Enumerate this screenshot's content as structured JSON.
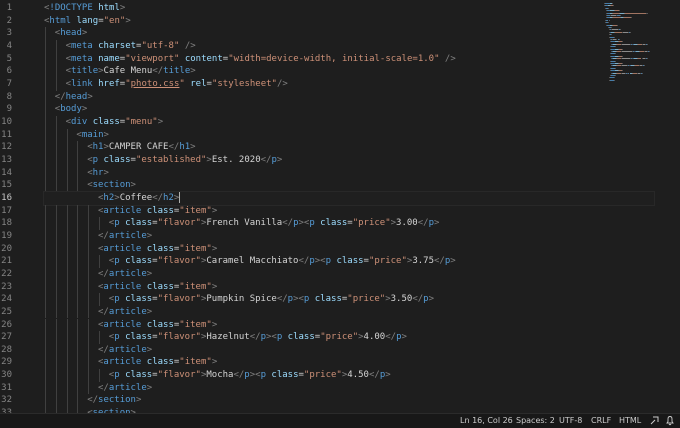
{
  "editor": {
    "active_line": 16,
    "lines": [
      {
        "n": "1",
        "indent": 0,
        "tokens": [
          [
            "br",
            "<"
          ],
          [
            "doc",
            "!DOCTYPE "
          ],
          [
            "attr",
            "html"
          ],
          [
            "br",
            ">"
          ]
        ]
      },
      {
        "n": "2",
        "indent": 0,
        "tokens": [
          [
            "br",
            "<"
          ],
          [
            "tag",
            "html "
          ],
          [
            "attr",
            "lang"
          ],
          [
            "eq",
            "="
          ],
          [
            "val",
            "\"en\""
          ],
          [
            "br",
            ">"
          ]
        ]
      },
      {
        "n": "3",
        "indent": 1,
        "tokens": [
          [
            "br",
            "<"
          ],
          [
            "tag",
            "head"
          ],
          [
            "br",
            ">"
          ]
        ]
      },
      {
        "n": "4",
        "indent": 2,
        "tokens": [
          [
            "br",
            "<"
          ],
          [
            "tag",
            "meta "
          ],
          [
            "attr",
            "charset"
          ],
          [
            "eq",
            "="
          ],
          [
            "val",
            "\"utf-8\""
          ],
          [
            "br",
            " />"
          ]
        ]
      },
      {
        "n": "5",
        "indent": 2,
        "tokens": [
          [
            "br",
            "<"
          ],
          [
            "tag",
            "meta "
          ],
          [
            "attr",
            "name"
          ],
          [
            "eq",
            "="
          ],
          [
            "val",
            "\"viewport\""
          ],
          [
            "txt",
            " "
          ],
          [
            "attr",
            "content"
          ],
          [
            "eq",
            "="
          ],
          [
            "val",
            "\"width=device-width, initial-scale=1.0\""
          ],
          [
            "br",
            " />"
          ]
        ]
      },
      {
        "n": "6",
        "indent": 2,
        "tokens": [
          [
            "br",
            "<"
          ],
          [
            "tag",
            "title"
          ],
          [
            "br",
            ">"
          ],
          [
            "txt",
            "Cafe Menu"
          ],
          [
            "br",
            "</"
          ],
          [
            "tag",
            "title"
          ],
          [
            "br",
            ">"
          ]
        ]
      },
      {
        "n": "7",
        "indent": 2,
        "tokens": [
          [
            "br",
            "<"
          ],
          [
            "tag",
            "link "
          ],
          [
            "attr",
            "href"
          ],
          [
            "eq",
            "="
          ],
          [
            "val",
            "\""
          ],
          [
            "link",
            "photo.css"
          ],
          [
            "val",
            "\""
          ],
          [
            "txt",
            " "
          ],
          [
            "attr",
            "rel"
          ],
          [
            "eq",
            "="
          ],
          [
            "val",
            "\"stylesheet\""
          ],
          [
            "br",
            "/>"
          ]
        ]
      },
      {
        "n": "8",
        "indent": 1,
        "tokens": [
          [
            "br",
            "</"
          ],
          [
            "tag",
            "head"
          ],
          [
            "br",
            ">"
          ]
        ]
      },
      {
        "n": "9",
        "indent": 1,
        "tokens": [
          [
            "br",
            "<"
          ],
          [
            "tag",
            "body"
          ],
          [
            "br",
            ">"
          ]
        ]
      },
      {
        "n": "10",
        "indent": 2,
        "tokens": [
          [
            "br",
            "<"
          ],
          [
            "tag",
            "div "
          ],
          [
            "attr",
            "class"
          ],
          [
            "eq",
            "="
          ],
          [
            "val",
            "\"menu\""
          ],
          [
            "br",
            ">"
          ]
        ]
      },
      {
        "n": "11",
        "indent": 3,
        "tokens": [
          [
            "br",
            "<"
          ],
          [
            "tag",
            "main"
          ],
          [
            "br",
            ">"
          ]
        ]
      },
      {
        "n": "12",
        "indent": 4,
        "tokens": [
          [
            "br",
            "<"
          ],
          [
            "tag",
            "h1"
          ],
          [
            "br",
            ">"
          ],
          [
            "txt",
            "CAMPER CAFE"
          ],
          [
            "br",
            "</"
          ],
          [
            "tag",
            "h1"
          ],
          [
            "br",
            ">"
          ]
        ]
      },
      {
        "n": "13",
        "indent": 4,
        "tokens": [
          [
            "br",
            "<"
          ],
          [
            "tag",
            "p "
          ],
          [
            "attr",
            "class"
          ],
          [
            "eq",
            "="
          ],
          [
            "val",
            "\"established\""
          ],
          [
            "br",
            ">"
          ],
          [
            "txt",
            "Est. 2020"
          ],
          [
            "br",
            "</"
          ],
          [
            "tag",
            "p"
          ],
          [
            "br",
            ">"
          ]
        ]
      },
      {
        "n": "14",
        "indent": 4,
        "tokens": [
          [
            "br",
            "<"
          ],
          [
            "tag",
            "hr"
          ],
          [
            "br",
            ">"
          ]
        ]
      },
      {
        "n": "15",
        "indent": 4,
        "tokens": [
          [
            "br",
            "<"
          ],
          [
            "tag",
            "section"
          ],
          [
            "br",
            ">"
          ]
        ]
      },
      {
        "n": "16",
        "indent": 5,
        "tokens": [
          [
            "br",
            "<"
          ],
          [
            "tag",
            "h2"
          ],
          [
            "br",
            ">"
          ],
          [
            "txt",
            "Coffee"
          ],
          [
            "br",
            "</"
          ],
          [
            "tag",
            "h2"
          ],
          [
            "br",
            ">"
          ],
          [
            "cursor",
            ""
          ]
        ]
      },
      {
        "n": "17",
        "indent": 5,
        "tokens": [
          [
            "br",
            "<"
          ],
          [
            "tag",
            "article "
          ],
          [
            "attr",
            "class"
          ],
          [
            "eq",
            "="
          ],
          [
            "val",
            "\"item\""
          ],
          [
            "br",
            ">"
          ]
        ]
      },
      {
        "n": "18",
        "indent": 6,
        "tokens": [
          [
            "br",
            "<"
          ],
          [
            "tag",
            "p "
          ],
          [
            "attr",
            "class"
          ],
          [
            "eq",
            "="
          ],
          [
            "val",
            "\"flavor\""
          ],
          [
            "br",
            ">"
          ],
          [
            "txt",
            "French Vanilla"
          ],
          [
            "br",
            "</"
          ],
          [
            "tag",
            "p"
          ],
          [
            "br",
            "><"
          ],
          [
            "tag",
            "p "
          ],
          [
            "attr",
            "class"
          ],
          [
            "eq",
            "="
          ],
          [
            "val",
            "\"price\""
          ],
          [
            "br",
            ">"
          ],
          [
            "txt",
            "3.00"
          ],
          [
            "br",
            "</"
          ],
          [
            "tag",
            "p"
          ],
          [
            "br",
            ">"
          ]
        ]
      },
      {
        "n": "19",
        "indent": 5,
        "tokens": [
          [
            "br",
            "</"
          ],
          [
            "tag",
            "article"
          ],
          [
            "br",
            ">"
          ]
        ]
      },
      {
        "n": "20",
        "indent": 5,
        "tokens": [
          [
            "br",
            "<"
          ],
          [
            "tag",
            "article "
          ],
          [
            "attr",
            "class"
          ],
          [
            "eq",
            "="
          ],
          [
            "val",
            "\"item\""
          ],
          [
            "br",
            ">"
          ]
        ]
      },
      {
        "n": "21",
        "indent": 6,
        "tokens": [
          [
            "br",
            "<"
          ],
          [
            "tag",
            "p "
          ],
          [
            "attr",
            "class"
          ],
          [
            "eq",
            "="
          ],
          [
            "val",
            "\"flavor\""
          ],
          [
            "br",
            ">"
          ],
          [
            "txt",
            "Caramel Macchiato"
          ],
          [
            "br",
            "</"
          ],
          [
            "tag",
            "p"
          ],
          [
            "br",
            "><"
          ],
          [
            "tag",
            "p "
          ],
          [
            "attr",
            "class"
          ],
          [
            "eq",
            "="
          ],
          [
            "val",
            "\"price\""
          ],
          [
            "br",
            ">"
          ],
          [
            "txt",
            "3.75"
          ],
          [
            "br",
            "</"
          ],
          [
            "tag",
            "p"
          ],
          [
            "br",
            ">"
          ]
        ]
      },
      {
        "n": "22",
        "indent": 5,
        "tokens": [
          [
            "br",
            "</"
          ],
          [
            "tag",
            "article"
          ],
          [
            "br",
            ">"
          ]
        ]
      },
      {
        "n": "23",
        "indent": 5,
        "tokens": [
          [
            "br",
            "<"
          ],
          [
            "tag",
            "article "
          ],
          [
            "attr",
            "class"
          ],
          [
            "eq",
            "="
          ],
          [
            "val",
            "\"item\""
          ],
          [
            "br",
            ">"
          ]
        ]
      },
      {
        "n": "24",
        "indent": 6,
        "tokens": [
          [
            "br",
            "<"
          ],
          [
            "tag",
            "p "
          ],
          [
            "attr",
            "class"
          ],
          [
            "eq",
            "="
          ],
          [
            "val",
            "\"flavor\""
          ],
          [
            "br",
            ">"
          ],
          [
            "txt",
            "Pumpkin Spice"
          ],
          [
            "br",
            "</"
          ],
          [
            "tag",
            "p"
          ],
          [
            "br",
            "><"
          ],
          [
            "tag",
            "p "
          ],
          [
            "attr",
            "class"
          ],
          [
            "eq",
            "="
          ],
          [
            "val",
            "\"price\""
          ],
          [
            "br",
            ">"
          ],
          [
            "txt",
            "3.50"
          ],
          [
            "br",
            "</"
          ],
          [
            "tag",
            "p"
          ],
          [
            "br",
            ">"
          ]
        ]
      },
      {
        "n": "25",
        "indent": 5,
        "tokens": [
          [
            "br",
            "</"
          ],
          [
            "tag",
            "article"
          ],
          [
            "br",
            ">"
          ]
        ]
      },
      {
        "n": "26",
        "indent": 5,
        "tokens": [
          [
            "br",
            "<"
          ],
          [
            "tag",
            "article "
          ],
          [
            "attr",
            "class"
          ],
          [
            "eq",
            "="
          ],
          [
            "val",
            "\"item\""
          ],
          [
            "br",
            ">"
          ]
        ]
      },
      {
        "n": "27",
        "indent": 6,
        "tokens": [
          [
            "br",
            "<"
          ],
          [
            "tag",
            "p "
          ],
          [
            "attr",
            "class"
          ],
          [
            "eq",
            "="
          ],
          [
            "val",
            "\"flavor\""
          ],
          [
            "br",
            ">"
          ],
          [
            "txt",
            "Hazelnut"
          ],
          [
            "br",
            "</"
          ],
          [
            "tag",
            "p"
          ],
          [
            "br",
            "><"
          ],
          [
            "tag",
            "p "
          ],
          [
            "attr",
            "class"
          ],
          [
            "eq",
            "="
          ],
          [
            "val",
            "\"price\""
          ],
          [
            "br",
            ">"
          ],
          [
            "txt",
            "4.00"
          ],
          [
            "br",
            "</"
          ],
          [
            "tag",
            "p"
          ],
          [
            "br",
            ">"
          ]
        ]
      },
      {
        "n": "28",
        "indent": 5,
        "tokens": [
          [
            "br",
            "</"
          ],
          [
            "tag",
            "article"
          ],
          [
            "br",
            ">"
          ]
        ]
      },
      {
        "n": "29",
        "indent": 5,
        "tokens": [
          [
            "br",
            "<"
          ],
          [
            "tag",
            "article "
          ],
          [
            "attr",
            "class"
          ],
          [
            "eq",
            "="
          ],
          [
            "val",
            "\"item\""
          ],
          [
            "br",
            ">"
          ]
        ]
      },
      {
        "n": "30",
        "indent": 6,
        "tokens": [
          [
            "br",
            "<"
          ],
          [
            "tag",
            "p "
          ],
          [
            "attr",
            "class"
          ],
          [
            "eq",
            "="
          ],
          [
            "val",
            "\"flavor\""
          ],
          [
            "br",
            ">"
          ],
          [
            "txt",
            "Mocha"
          ],
          [
            "br",
            "</"
          ],
          [
            "tag",
            "p"
          ],
          [
            "br",
            "><"
          ],
          [
            "tag",
            "p "
          ],
          [
            "attr",
            "class"
          ],
          [
            "eq",
            "="
          ],
          [
            "val",
            "\"price\""
          ],
          [
            "br",
            ">"
          ],
          [
            "txt",
            "4.50"
          ],
          [
            "br",
            "</"
          ],
          [
            "tag",
            "p"
          ],
          [
            "br",
            ">"
          ]
        ]
      },
      {
        "n": "31",
        "indent": 5,
        "tokens": [
          [
            "br",
            "</"
          ],
          [
            "tag",
            "article"
          ],
          [
            "br",
            ">"
          ]
        ]
      },
      {
        "n": "32",
        "indent": 4,
        "tokens": [
          [
            "br",
            "</"
          ],
          [
            "tag",
            "section"
          ],
          [
            "br",
            ">"
          ]
        ]
      },
      {
        "n": "33",
        "indent": 4,
        "tokens": [
          [
            "br",
            "<"
          ],
          [
            "tag",
            "section"
          ],
          [
            "br",
            ">"
          ]
        ]
      }
    ]
  },
  "statusbar": {
    "position": "Ln 16, Col 26",
    "spaces": "Spaces: 2",
    "encoding": "UTF-8",
    "eol": "CRLF",
    "language": "HTML",
    "icons": [
      "live-share-icon",
      "bell-icon"
    ]
  },
  "colors": {
    "background": "#1e1e1e",
    "tag": "#569cd6",
    "attribute": "#9cdcfe",
    "string": "#ce9178",
    "bracket": "#808080",
    "text": "#d4d4d4",
    "line_number": "#858585"
  }
}
